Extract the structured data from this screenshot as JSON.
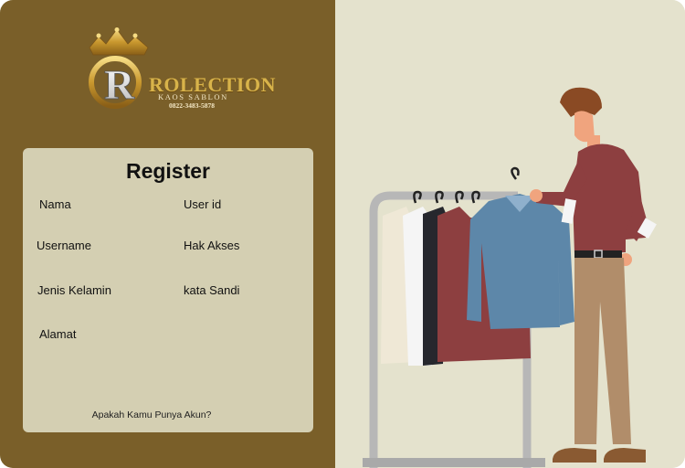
{
  "brand": {
    "logo_word": "ROLECTION",
    "logo_subtitle": "KAOS SABLON",
    "logo_phone": "0822-3483-5878"
  },
  "form": {
    "title": "Register",
    "fields": {
      "nama": "Nama",
      "user_id": "User id",
      "username": "Username",
      "hak_akses": "Hak Akses",
      "jenis_kelamin": "Jenis Kelamin",
      "kata_sandi": "kata Sandi",
      "alamat": "Alamat"
    },
    "login_prompt": "Apakah Kamu Punya Akun?"
  },
  "colors": {
    "left_panel": "#7a5f29",
    "right_panel": "#e4e2cd",
    "card": "#d4cfb2",
    "gold": "#d8b34a"
  }
}
